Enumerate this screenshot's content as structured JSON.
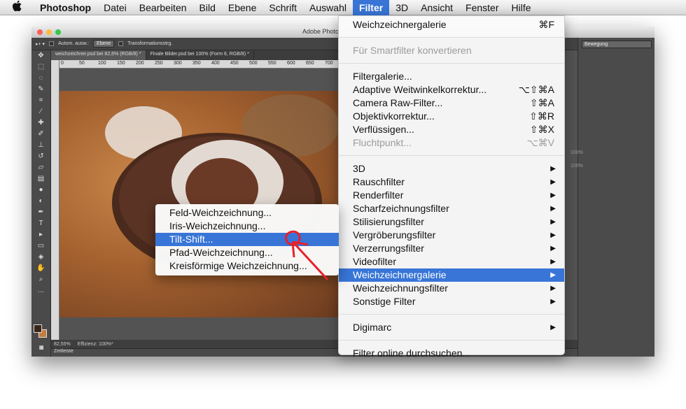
{
  "menubar": {
    "apple": "",
    "app": "Photoshop",
    "items": [
      "Datei",
      "Bearbeiten",
      "Bild",
      "Ebene",
      "Schrift",
      "Auswahl"
    ],
    "active": "Filter",
    "after": [
      "3D",
      "Ansicht",
      "Fenster",
      "Hilfe"
    ]
  },
  "window": {
    "title": "Adobe Photo",
    "options": {
      "auto_select": "Autom. ausw.:",
      "layer": "Ebene",
      "transform": "Transformationsstrg."
    },
    "tabs": [
      "weichzeichner.psd bei 82,6% (RGB/8) *",
      "Finale Bilder.psd bei 100% (Form 6, RGB/8) *"
    ],
    "ruler": [
      "0",
      "50",
      "100",
      "150",
      "200",
      "250",
      "300",
      "350",
      "400",
      "450",
      "500",
      "550",
      "600",
      "650",
      "700"
    ],
    "status": {
      "zoom": "82,55%",
      "efficiency": "Effizienz: 100%*"
    },
    "timeline": "Zeitleiste",
    "workspace": "Bewegung",
    "opacity_a": "100%",
    "opacity_b": "100%"
  },
  "filter_menu": {
    "group1": [
      {
        "label": "Weichzeichnergalerie",
        "shortcut": "⌘F",
        "disabled": false
      }
    ],
    "group2": [
      {
        "label": "Für Smartfilter konvertieren",
        "shortcut": "",
        "disabled": true
      }
    ],
    "group3": [
      {
        "label": "Filtergalerie...",
        "shortcut": "",
        "disabled": false
      },
      {
        "label": "Adaptive Weitwinkelkorrektur...",
        "shortcut": "⌥⇧⌘A",
        "disabled": false
      },
      {
        "label": "Camera Raw-Filter...",
        "shortcut": "⇧⌘A",
        "disabled": false
      },
      {
        "label": "Objektivkorrektur...",
        "shortcut": "⇧⌘R",
        "disabled": false
      },
      {
        "label": "Verflüssigen...",
        "shortcut": "⇧⌘X",
        "disabled": false
      },
      {
        "label": "Fluchtpunkt...",
        "shortcut": "⌥⌘V",
        "disabled": true
      }
    ],
    "group4": [
      {
        "label": "3D"
      },
      {
        "label": "Rauschfilter"
      },
      {
        "label": "Renderfilter"
      },
      {
        "label": "Scharfzeichnungsfilter"
      },
      {
        "label": "Stilisierungsfilter"
      },
      {
        "label": "Vergröberungsfilter"
      },
      {
        "label": "Verzerrungsfilter"
      },
      {
        "label": "Videofilter"
      },
      {
        "label": "Weichzeichnergalerie",
        "highlighted": true
      },
      {
        "label": "Weichzeichnungsfilter"
      },
      {
        "label": "Sonstige Filter"
      }
    ],
    "group5": [
      {
        "label": "Digimarc"
      }
    ],
    "group6": [
      {
        "label": "Filter online durchsuchen...",
        "shortcut": ""
      }
    ],
    "submenu_arrow": "▶"
  },
  "submenu": {
    "items": [
      "Feld-Weichzeichnung...",
      "Iris-Weichzeichnung...",
      "Tilt-Shift...",
      "Pfad-Weichzeichnung...",
      "Kreisförmige Weichzeichnung..."
    ],
    "highlighted": 2
  },
  "colors": {
    "highlight": "#3875d7",
    "annotation": "#e8202a"
  }
}
